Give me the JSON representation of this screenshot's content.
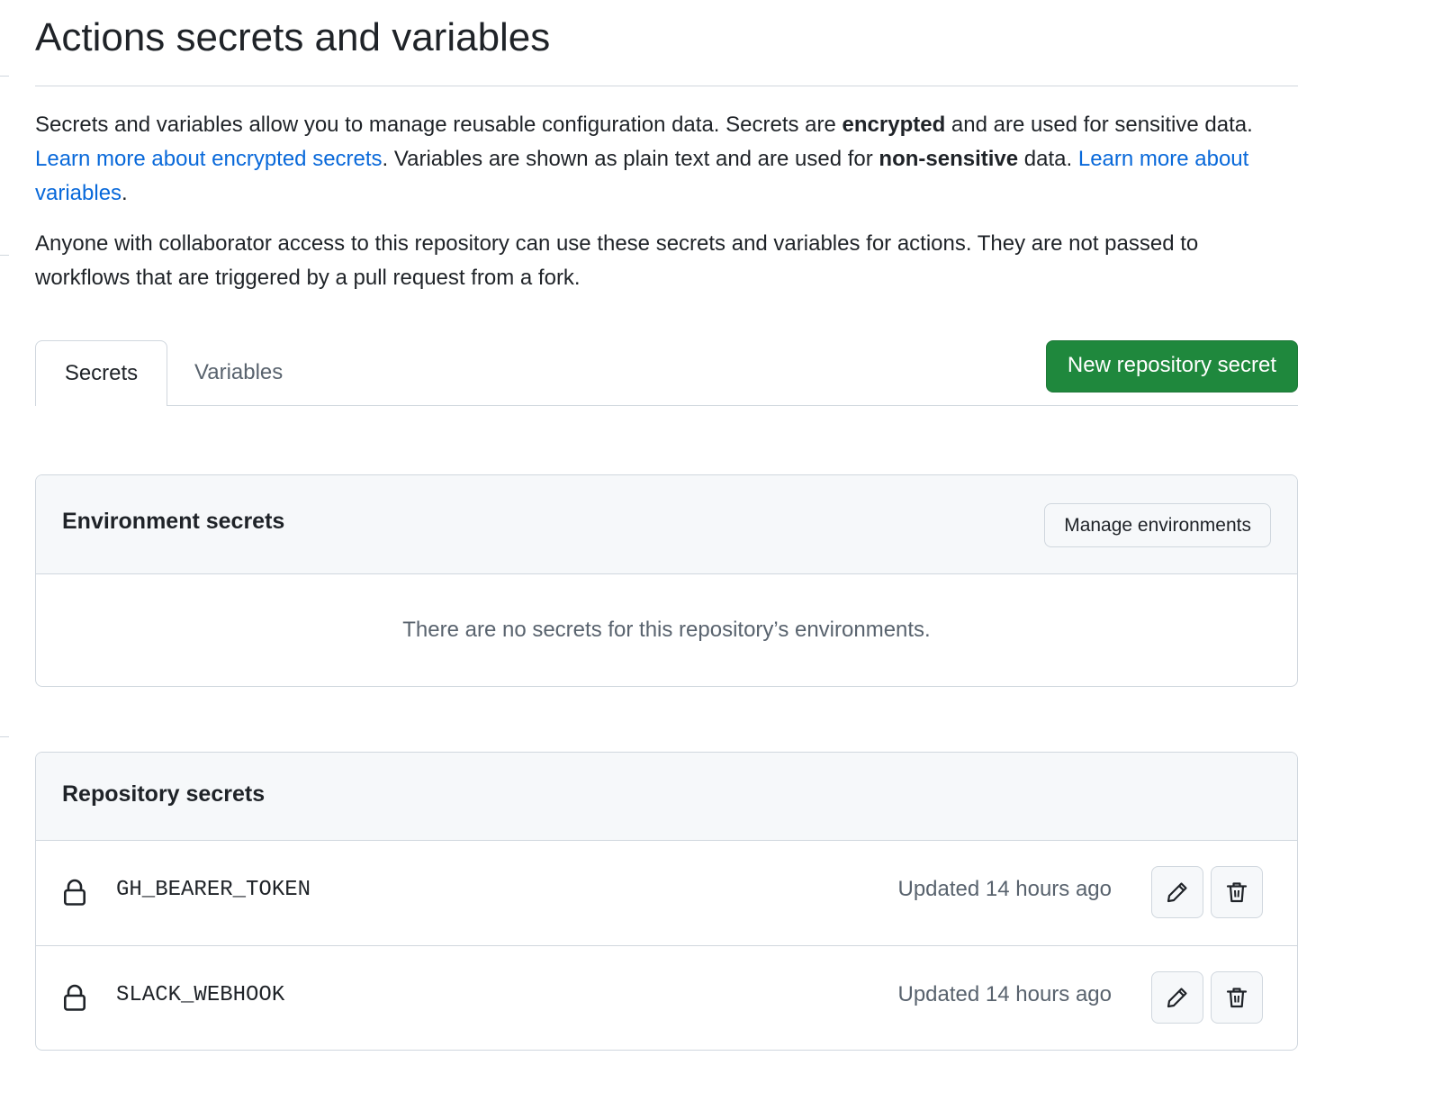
{
  "page": {
    "title": "Actions secrets and variables"
  },
  "intro": {
    "p1_text_a": "Secrets and variables allow you to manage reusable configuration data. Secrets are ",
    "p1_bold_a": "encrypted",
    "p1_text_b": " and are used for sensitive data. ",
    "p1_link_a": "Learn more about encrypted secrets",
    "p1_text_c": ". Variables are shown as plain text and are used for ",
    "p1_bold_b": "non-sensitive",
    "p1_text_d": " data. ",
    "p1_link_b": "Learn more about variables",
    "p1_text_e": ".",
    "p2_text": "Anyone with collaborator access to this repository can use these secrets and variables for actions. They are not passed to workflows that are triggered by a pull request from a fork."
  },
  "tabs": {
    "secrets_label": "Secrets",
    "variables_label": "Variables",
    "active": "Secrets"
  },
  "new_secret_button": "New repository secret",
  "environment_secrets": {
    "title": "Environment secrets",
    "manage_button": "Manage environments",
    "empty_message": "There are no secrets for this repository’s environments."
  },
  "repository_secrets": {
    "title": "Repository secrets",
    "items": [
      {
        "name": "GH_BEARER_TOKEN",
        "updated": "Updated 14 hours ago",
        "icon": "lock-icon"
      },
      {
        "name": "SLACK_WEBHOOK",
        "updated": "Updated 14 hours ago",
        "icon": "lock-icon"
      }
    ]
  },
  "colors": {
    "primary_button": "#1f883d",
    "link": "#0969da",
    "border": "#d0d7de",
    "header_bg": "#f6f8fa",
    "muted_text": "#59636e"
  }
}
